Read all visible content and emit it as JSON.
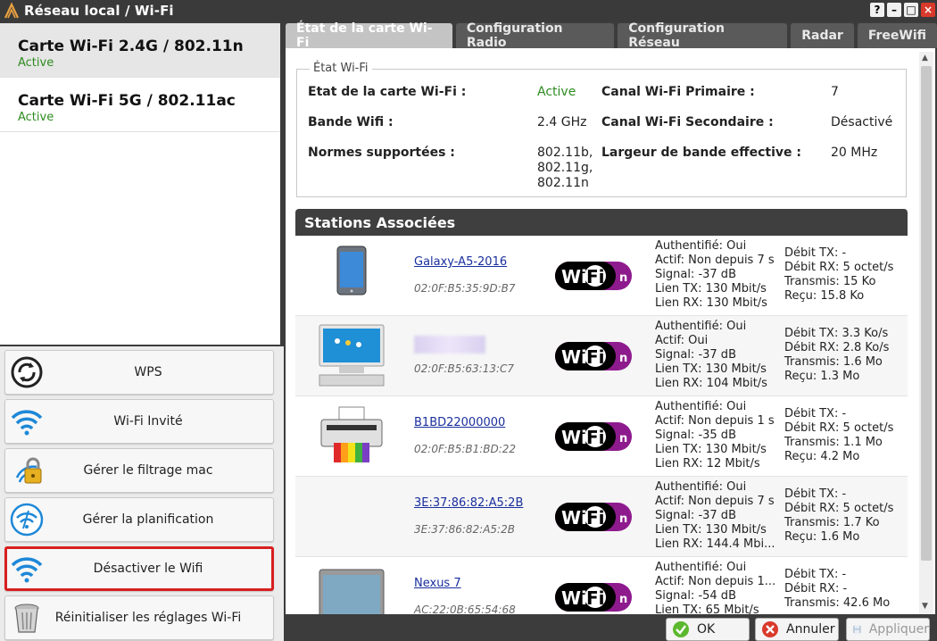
{
  "window": {
    "title": "Réseau local / Wi-Fi",
    "buttons": [
      "?",
      "–",
      "□",
      "×"
    ]
  },
  "cards": [
    {
      "name": "Carte Wi-Fi 2.4G / 802.11n",
      "status": "Active",
      "selected": true
    },
    {
      "name": "Carte Wi-Fi 5G / 802.11ac",
      "status": "Active",
      "selected": false
    }
  ],
  "actions": [
    {
      "label": "WPS",
      "icon": "wps-icon"
    },
    {
      "label": "Wi-Fi Invité",
      "icon": "wifi-icon"
    },
    {
      "label": "Gérer le filtrage mac",
      "icon": "lock-icon"
    },
    {
      "label": "Gérer la planification",
      "icon": "schedule-icon"
    },
    {
      "label": "Désactiver le Wifi",
      "icon": "wifi-icon",
      "highlighted": true
    },
    {
      "label": "Réinitialiser les réglages Wi-Fi",
      "icon": "trash-icon"
    }
  ],
  "tabs": [
    {
      "label": "État de la carte Wi-Fi",
      "active": true
    },
    {
      "label": "Configuration Radio",
      "active": false
    },
    {
      "label": "Configuration Réseau",
      "active": false
    },
    {
      "label": "Radar",
      "active": false
    },
    {
      "label": "FreeWifi",
      "active": false
    }
  ],
  "wifi_state": {
    "legend": "État Wi-Fi",
    "card_state_label": "Etat de la carte Wi-Fi :",
    "card_state_value": "Active",
    "band_label": "Bande Wifi :",
    "band_value": "2.4 GHz",
    "norms_label": "Normes supportées :",
    "norms_value": [
      "802.11b,",
      "802.11g,",
      "802.11n"
    ],
    "primary_channel_label": "Canal Wi-Fi Primaire :",
    "primary_channel_value": "7",
    "secondary_channel_label": "Canal Wi-Fi Secondaire :",
    "secondary_channel_value": "Désactivé",
    "bandwidth_label": "Largeur de bande effective :",
    "bandwidth_value": "20 MHz"
  },
  "stations_title": "Stations Associées",
  "wifi_logo_text": {
    "wi": "Wi",
    "fi": "Fi",
    "n": "n"
  },
  "stations": [
    {
      "device": "tablet",
      "name": "Galaxy-A5-2016",
      "mac": "02:0F:B5:35:9D:B7",
      "info1": [
        "Authentifié: Oui",
        "Actif: Non depuis 7 s",
        "Signal: -37 dB",
        "Lien TX: 130 Mbit/s",
        "Lien RX: 130 Mbit/s"
      ],
      "info2": [
        "Débit TX: -",
        "Débit RX: 5 octet/s",
        "Transmis: 15 Ko",
        "Reçu: 15.8 Ko"
      ]
    },
    {
      "device": "computer",
      "name": "",
      "mac": "02:0F:B5:63:13:C7",
      "info1": [
        "Authentifié: Oui",
        "Actif: Oui",
        "Signal: -37 dB",
        "Lien TX: 130 Mbit/s",
        "Lien RX: 104 Mbit/s"
      ],
      "info2": [
        "Débit TX: 3.3 Ko/s",
        "Débit RX: 2.8 Ko/s",
        "Transmis: 1.6 Mo",
        "Reçu: 1.3 Mo"
      ]
    },
    {
      "device": "printer",
      "name": "B1BD22000000",
      "mac": "02:0F:B5:B1:BD:22",
      "info1": [
        "Authentifié: Oui",
        "Actif: Non depuis 1 s",
        "Signal: -35 dB",
        "Lien TX: 130 Mbit/s",
        "Lien RX: 12 Mbit/s"
      ],
      "info2": [
        "Débit TX: -",
        "Débit RX: 5 octet/s",
        "Transmis: 1.1 Mo",
        "Reçu: 4.2 Mo"
      ]
    },
    {
      "device": "none",
      "name": "3E:37:86:82:A5:2B",
      "mac": "3E:37:86:82:A5:2B",
      "info1": [
        "Authentifié: Oui",
        "Actif: Non depuis 7 s",
        "Signal: -37 dB",
        "Lien TX: 130 Mbit/s",
        "Lien RX: 144.4 Mbi..."
      ],
      "info2": [
        "Débit TX: -",
        "Débit RX: 5 octet/s",
        "Transmis: 1.7 Ko",
        "Reçu: 1.6 Mo"
      ]
    },
    {
      "device": "tablet-large",
      "name": "Nexus 7",
      "mac": "AC:22:0B:65:54:68",
      "info1": [
        "Authentifié: Oui",
        "Actif: Non depuis 1...",
        "Signal: -54 dB",
        "Lien TX: 65 Mbit/s"
      ],
      "info2": [
        "Débit TX: -",
        "Débit RX: -",
        "Transmis: 42.6 Mo"
      ]
    }
  ],
  "bottom_buttons": [
    {
      "label": "OK",
      "icon": "check-icon",
      "enabled": true
    },
    {
      "label": "Annuler",
      "icon": "cancel-icon",
      "enabled": true
    },
    {
      "label": "Appliquer",
      "icon": "save-icon",
      "enabled": false
    }
  ],
  "colors": {
    "active_green": "#2e8b20",
    "link_blue": "#1a2f9e",
    "highlight_red": "#d81f1f",
    "dark_bg": "#3c3c3c"
  }
}
